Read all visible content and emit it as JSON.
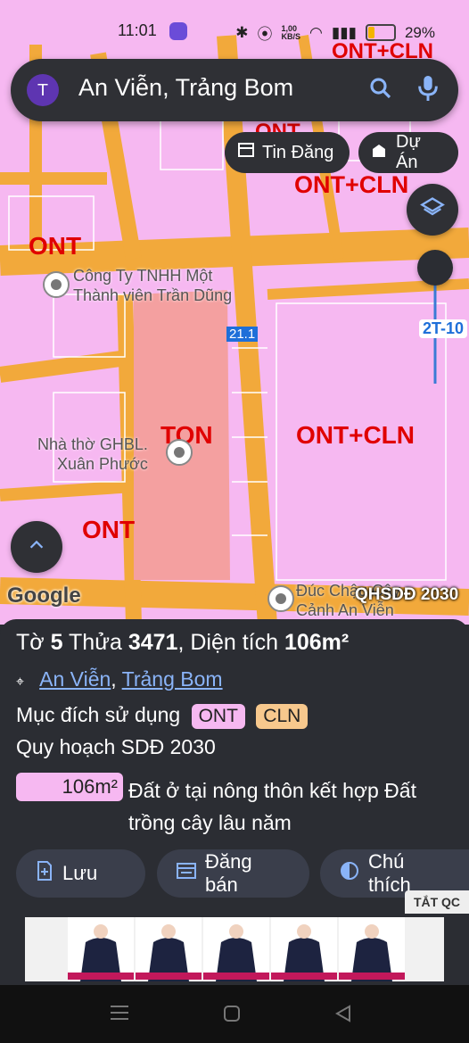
{
  "status_bar": {
    "time": "11:01",
    "speed": "1,00\nKB/S",
    "battery": "29%"
  },
  "search": {
    "avatar_letter": "T",
    "query": "An Viễn, Trảng Bom"
  },
  "top_buttons": {
    "posts": "Tin Đăng",
    "projects": "Dự Án"
  },
  "map": {
    "labels": {
      "ont1": "ONT",
      "ont2": "ONT",
      "ont_cln_top": "ONT+CLN",
      "ont_cln_top2": "ONT+CLN",
      "ont_cln_mid": "ONT+CLN",
      "ont_top_partial": "ONT",
      "ton": "TON",
      "road_code": "21.1",
      "road_code2": "2T-10"
    },
    "poi": {
      "company": "Công Ty TNHH Một\nThành viên Trần Dũng",
      "church": "Nhà thờ GHBL.\nXuân Phước",
      "bottom": "Đúc Chậu Cây\nCảnh An Viễn"
    },
    "google": "Google",
    "plan_badge": "QHSDĐ 2030"
  },
  "sheet": {
    "parcel": {
      "to_label": "Tờ",
      "to": "5",
      "thua_label": "Thửa",
      "thua": "3471",
      "area_label": "Diện tích",
      "area": "106m²"
    },
    "location": {
      "commune": "An Viễn",
      "district": "Trảng Bom"
    },
    "purpose": {
      "label": "Mục đích sử dụng",
      "codes": [
        "ONT",
        "CLN"
      ],
      "colors": [
        "#f6b8f1",
        "#f7c88d"
      ]
    },
    "plan": "Quy hoạch SDĐ 2030",
    "area_chip": "106m²",
    "area_desc": "Đất ở tại nông thôn kết hợp Đất trồng cây lâu năm",
    "buttons": {
      "save": "Lưu",
      "sell": "Đăng bán",
      "legend": "Chú thích"
    },
    "ad_close": "TẮT QC"
  }
}
